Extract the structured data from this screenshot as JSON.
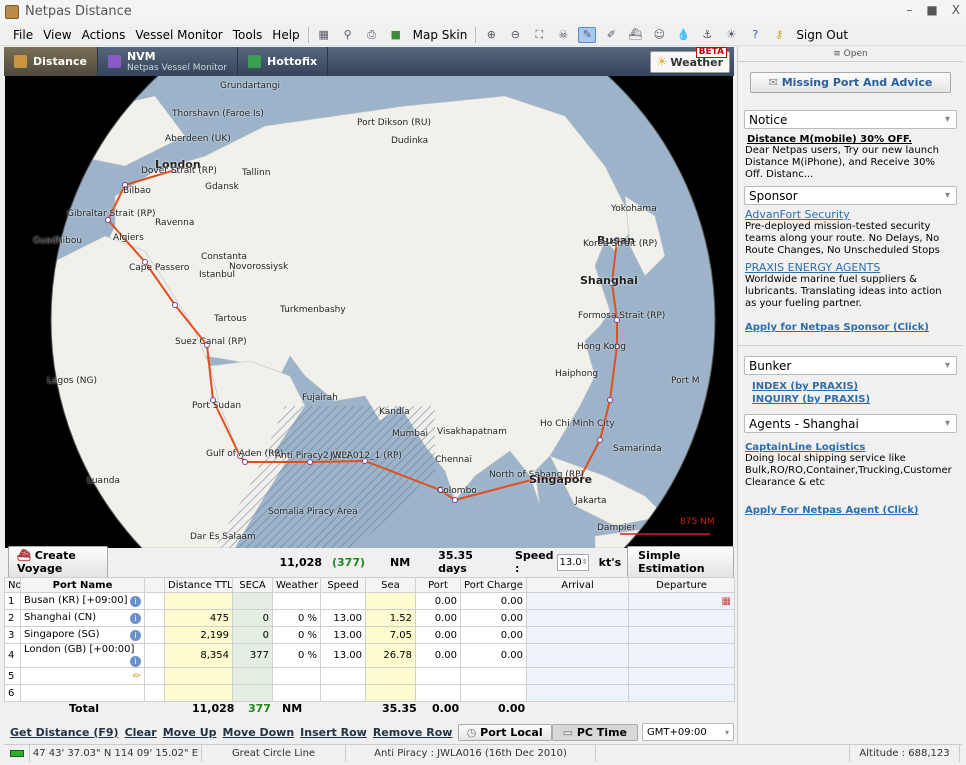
{
  "window": {
    "title": "Netpas Distance",
    "minimize": "–",
    "maximize": "■",
    "close": "X"
  },
  "menu": [
    "File",
    "View",
    "Actions",
    "Vessel Monitor",
    "Tools",
    "Help"
  ],
  "toolbar": {
    "map_skin": "Map Skin",
    "sign_out": "Sign Out"
  },
  "tabs": [
    {
      "label": "Distance",
      "active": true
    },
    {
      "label": "NVM",
      "sub": "Netpas Vessel Monitor"
    },
    {
      "label": "Hottofix"
    }
  ],
  "weather": {
    "label": "Weather",
    "badge": "BETA"
  },
  "map": {
    "labels": [
      "Grundartangi",
      "Thorshavn (Faroe Is)",
      "Aberdeen (UK)",
      "London",
      "Dover Strait (RP)",
      "Gdansk",
      "Tallinn",
      "Bilbao",
      "Gibraltar Strait (RP)",
      "Ravenna",
      "Algiers",
      "Guadhibou",
      "Constanta",
      "Novorossiysk",
      "Istanbul",
      "Cape Passero",
      "Turkmenbashy",
      "Tartous",
      "Suez Canal (RP)",
      "Lagos (NG)",
      "Port Sudan",
      "Gulf of Aden (RP)",
      "Anti Piracy2 (RP)",
      "JWLA012_1 (RP)",
      "Fujairah",
      "Kandla",
      "Mumbai",
      "Visakhapatnam",
      "Chennai",
      "Colombo",
      "North of Sabang (RP)",
      "Singapore",
      "Jakarta",
      "Luanda",
      "Somalia Piracy Area",
      "Dar Es Salaam",
      "Port Dikson (RU)",
      "Dudinka",
      "Yokohama",
      "Busan",
      "Korea Strait (RP)",
      "Shanghai",
      "Formosa Strait (RP)",
      "Hong Kong",
      "Haiphong",
      "Ho Chi Minh City",
      "Samarinda",
      "Dampier",
      "Port M"
    ],
    "scale": "875 NM",
    "colors": {
      "ocean": "#9cb3c9",
      "land": "#f1f0ea",
      "route": "#e0501e"
    }
  },
  "voyage": {
    "create_label": "Create Voyage",
    "distance": "11,028",
    "seca": "(377)",
    "unit": "NM",
    "days": "35.35 days",
    "speed_label": "Speed :",
    "speed": "13.0",
    "speed_unit": "kt's",
    "estimate_label": "Simple Estimation"
  },
  "table": {
    "headers": [
      "No",
      "Port Name",
      "",
      "Distance TTL",
      "SECA",
      "Weather",
      "Speed",
      "Sea",
      "Port",
      "Port Charge",
      "Arrival",
      "Departure"
    ],
    "rows": [
      {
        "no": "1",
        "port": "Busan (KR) [+09:00]",
        "dist": "",
        "seca": "",
        "weather": "",
        "speed": "",
        "sea": "",
        "portd": "0.00",
        "charge": "0.00"
      },
      {
        "no": "2",
        "port": "Shanghai (CN)",
        "dist": "475",
        "seca": "0",
        "weather": "0 %",
        "speed": "13.00",
        "sea": "1.52",
        "portd": "0.00",
        "charge": "0.00"
      },
      {
        "no": "3",
        "port": "Singapore (SG)",
        "dist": "2,199",
        "seca": "0",
        "weather": "0 %",
        "speed": "13.00",
        "sea": "7.05",
        "portd": "0.00",
        "charge": "0.00"
      },
      {
        "no": "4",
        "port": "London (GB) [+00:00]",
        "dist": "8,354",
        "seca": "377",
        "weather": "0 %",
        "speed": "13.00",
        "sea": "26.78",
        "portd": "0.00",
        "charge": "0.00"
      },
      {
        "no": "5",
        "port": "",
        "dist": "",
        "seca": "",
        "weather": "",
        "speed": "",
        "sea": "",
        "portd": "",
        "charge": ""
      },
      {
        "no": "6",
        "port": "",
        "dist": "",
        "seca": "",
        "weather": "",
        "speed": "",
        "sea": "",
        "portd": "",
        "charge": ""
      }
    ],
    "total": {
      "label": "Total",
      "dist": "11,028",
      "seca": "377",
      "unit": "NM",
      "sea": "35.35",
      "port": "0.00",
      "charge": "0.00"
    }
  },
  "actions": [
    "Get Distance (F9)",
    "Clear",
    "Move Up",
    "Move Down",
    "Insert Row",
    "Remove Row"
  ],
  "time": {
    "port_local": "Port Local",
    "pc_time": "PC Time",
    "gmt": "GMT+09:00"
  },
  "status": {
    "coords": "47  43' 37.03\" N   114  09' 15.02\" E",
    "line": "Great Circle Line",
    "piracy": "Anti Piracy : JWLA016 (16th Dec 2010)",
    "altitude": "Altitude : 688,123"
  },
  "right": {
    "open": "Open",
    "missing": "Missing Port And Advice",
    "notice": {
      "title": "Notice",
      "headline": "Distance M(mobile) 30% OFF.",
      "text": "Dear Netpas users, Try our new launch Distance M(iPhone), and Receive 30% Off. Distanc..."
    },
    "sponsor": {
      "title": "Sponsor",
      "items": [
        {
          "name": "AdvanFort Security",
          "text": "Pre-deployed mission-tested security teams along your route. No Delays, No Route Changes, No Unscheduled Stops"
        },
        {
          "name": "PRAXIS ENERGY AGENTS",
          "text": "Worldwide marine fuel suppliers & lubricants. Translating ideas into action as your fueling partner."
        }
      ],
      "apply": "Apply for Netpas Sponsor (Click)"
    },
    "bunker": {
      "title": "Bunker",
      "links": [
        "INDEX (by PRAXIS)",
        "INQUIRY (by PRAXIS)"
      ]
    },
    "agents": {
      "title": "Agents - Shanghai",
      "name": "CaptainLine Logistics",
      "text": "Doing local shipping service like Bulk,RO/RO,Container,Trucking,Customer Clearance & etc",
      "apply": "Apply For Netpas Agent (Click)"
    }
  }
}
